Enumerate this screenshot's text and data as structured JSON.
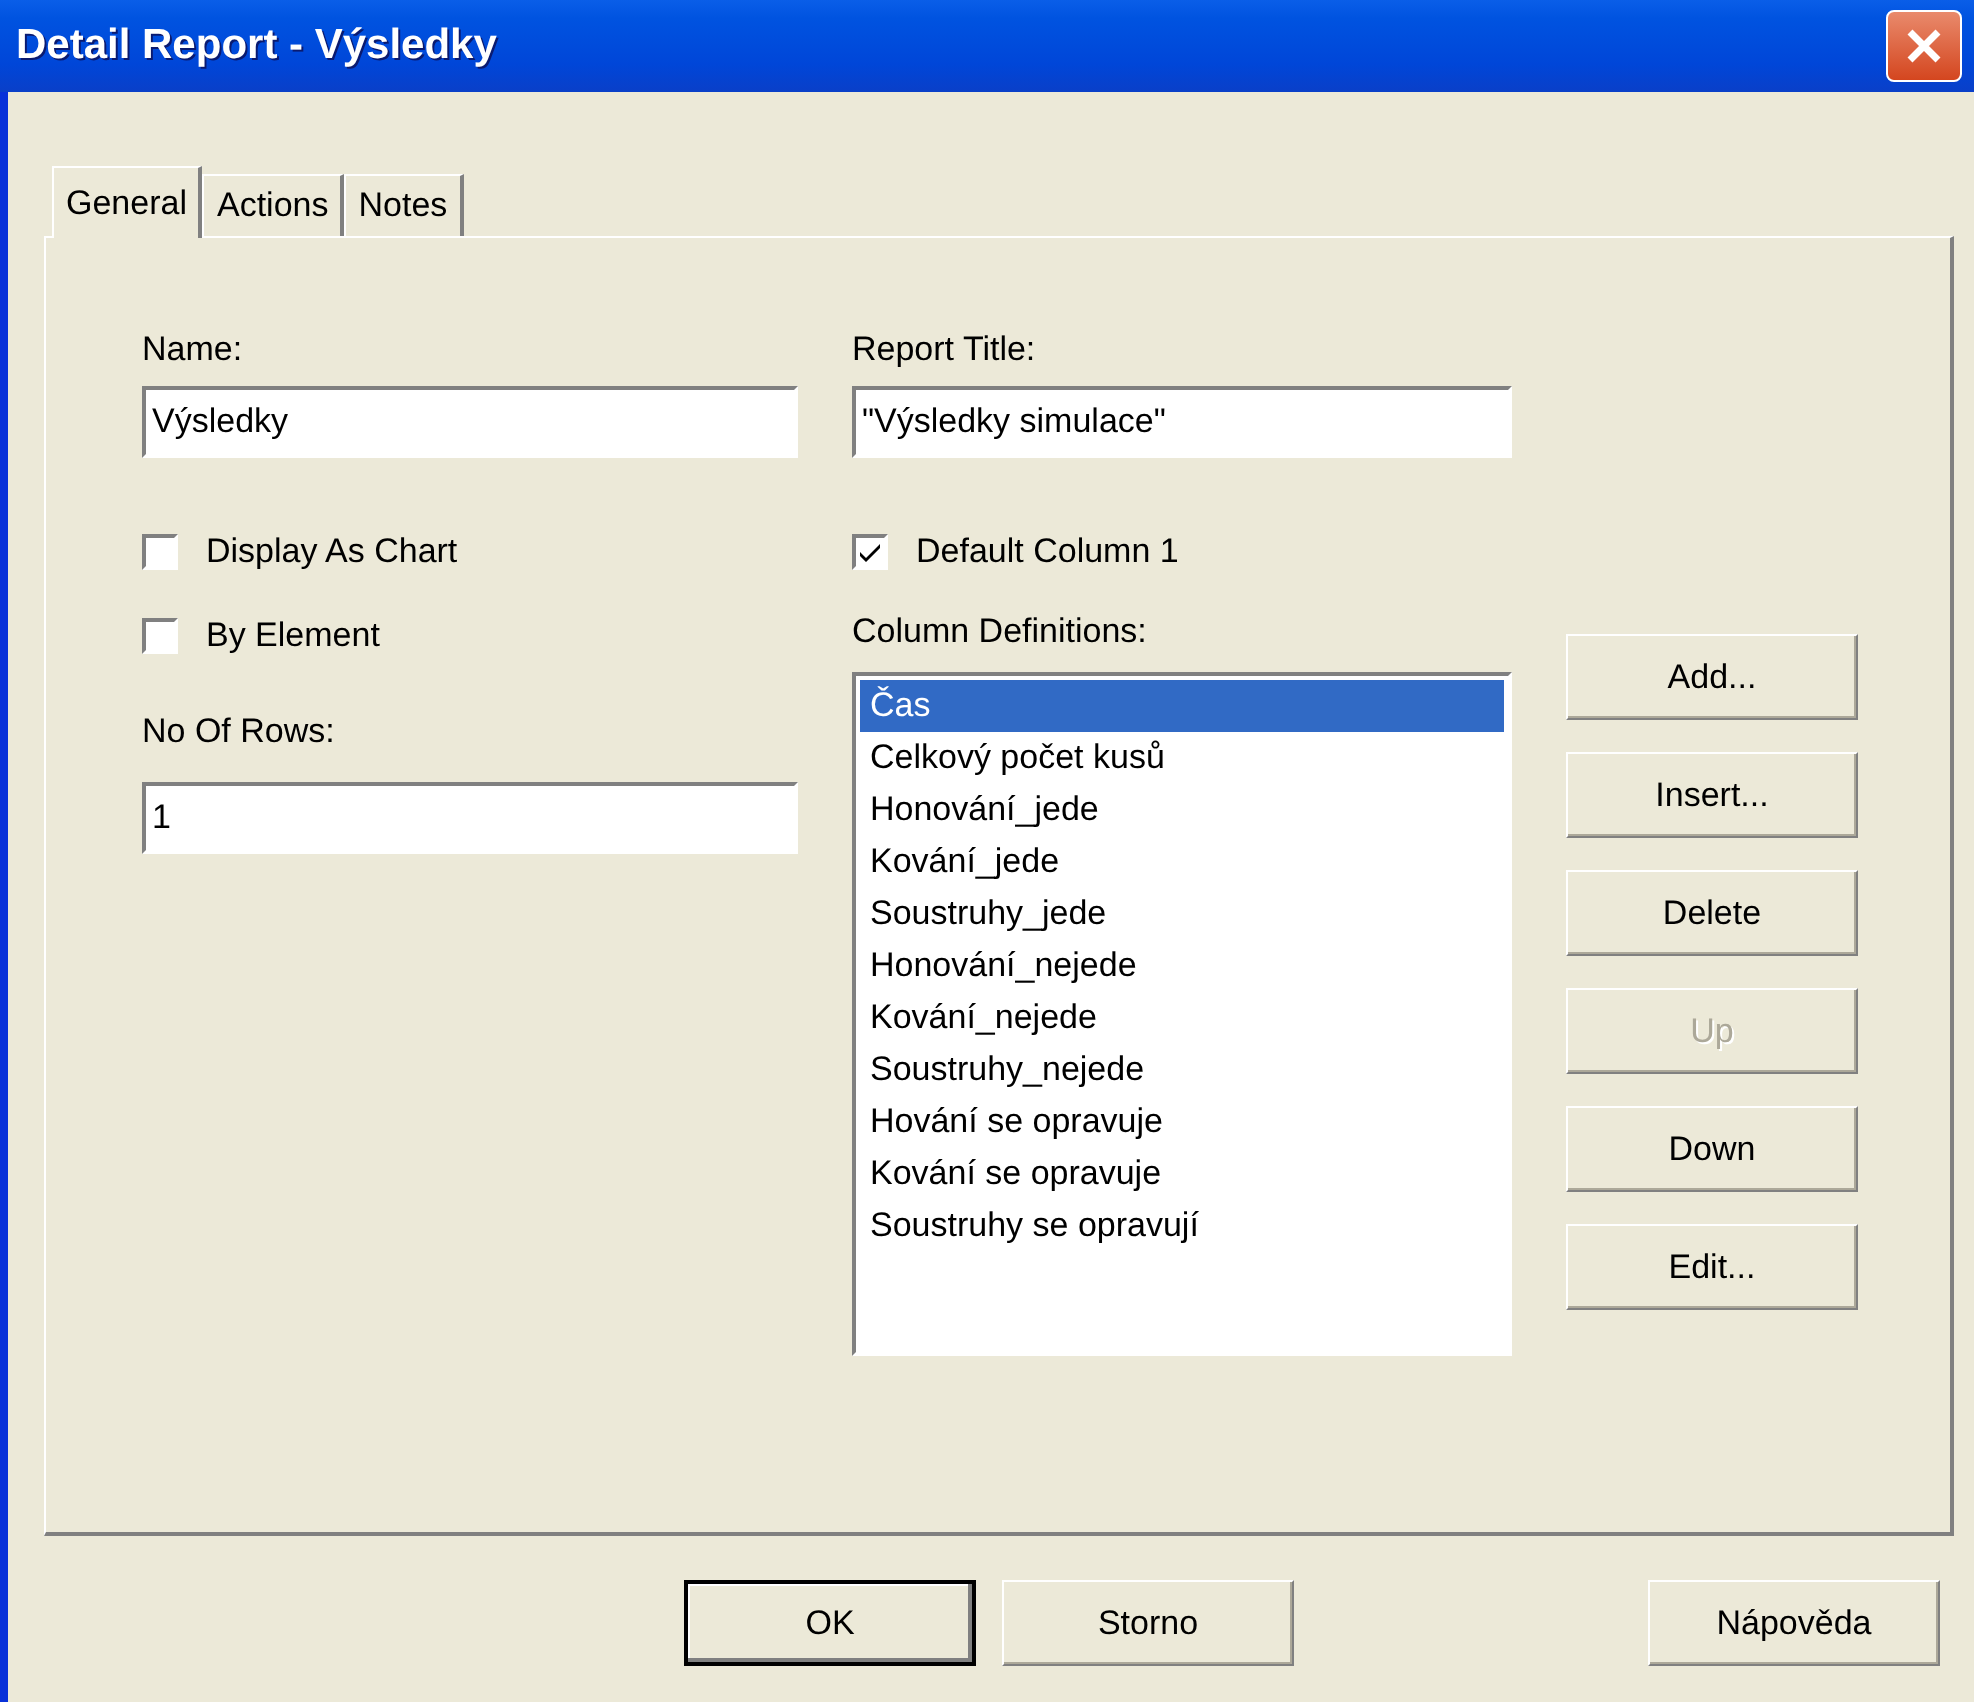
{
  "window": {
    "title": "Detail Report - Výsledky"
  },
  "tabs": [
    {
      "label": "General",
      "selected": true
    },
    {
      "label": "Actions",
      "selected": false
    },
    {
      "label": "Notes",
      "selected": false
    }
  ],
  "name": {
    "label": "Name:",
    "value": "Výsledky"
  },
  "report_title": {
    "label": "Report Title:",
    "value": "\"Výsledky simulace\""
  },
  "left_checkboxes": [
    {
      "label": "Display As Chart",
      "checked": false
    },
    {
      "label": "By Element",
      "checked": false
    }
  ],
  "no_of_rows": {
    "label": "No Of Rows:",
    "value": "1"
  },
  "default_column": {
    "label": "Default Column 1",
    "checked": true
  },
  "column_definitions": {
    "label": "Column Definitions:",
    "items": [
      {
        "label": "Čas",
        "selected": true
      },
      {
        "label": "Celkový počet kusů",
        "selected": false
      },
      {
        "label": "Honování_jede",
        "selected": false
      },
      {
        "label": "Kování_jede",
        "selected": false
      },
      {
        "label": "Soustruhy_jede",
        "selected": false
      },
      {
        "label": "Honování_nejede",
        "selected": false
      },
      {
        "label": "Kování_nejede",
        "selected": false
      },
      {
        "label": "Soustruhy_nejede",
        "selected": false
      },
      {
        "label": "Hování se opravuje",
        "selected": false
      },
      {
        "label": "Kování se opravuje",
        "selected": false
      },
      {
        "label": "Soustruhy se opravují",
        "selected": false
      }
    ]
  },
  "side_buttons": [
    {
      "label": "Add...",
      "disabled": false
    },
    {
      "label": "Insert...",
      "disabled": false
    },
    {
      "label": "Delete",
      "disabled": false
    },
    {
      "label": "Up",
      "disabled": true
    },
    {
      "label": "Down",
      "disabled": false
    },
    {
      "label": "Edit...",
      "disabled": false
    }
  ],
  "footer_buttons": [
    {
      "label": "OK",
      "default": true
    },
    {
      "label": "Storno",
      "default": false
    },
    {
      "label": "Nápověda",
      "default": false
    }
  ]
}
